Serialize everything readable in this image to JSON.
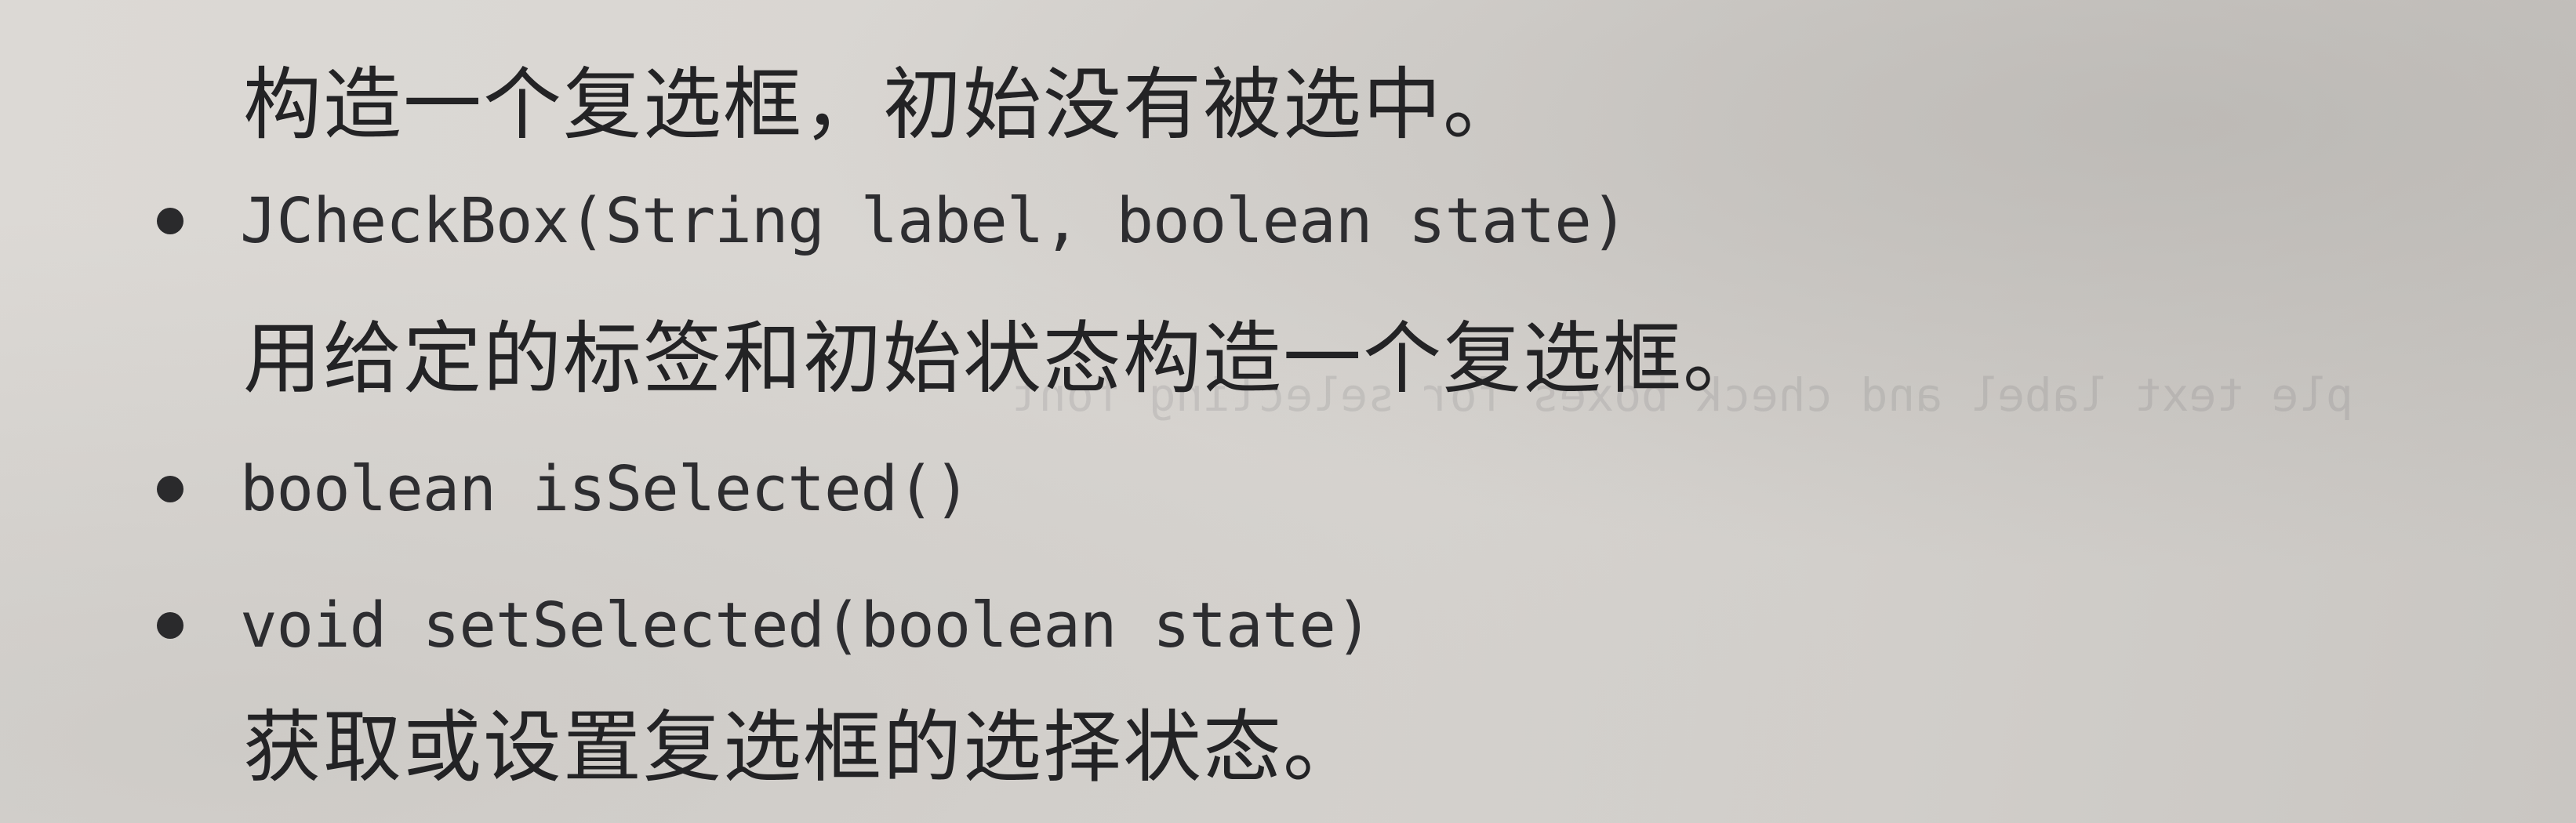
{
  "lines": {
    "desc_default": "构造一个复选框，初始没有被选中。",
    "sig_label_state": "JCheckBox(String label, boolean state)",
    "desc_label_state": "用给定的标签和初始状态构造一个复选框。",
    "sig_is_selected": "boolean isSelected()",
    "sig_set_selected": "void setSelected(boolean state)",
    "desc_selection": "获取或设置复选框的选择状态。"
  },
  "show_through": {
    "line1": "ple text label and check boxes for selecting font"
  }
}
